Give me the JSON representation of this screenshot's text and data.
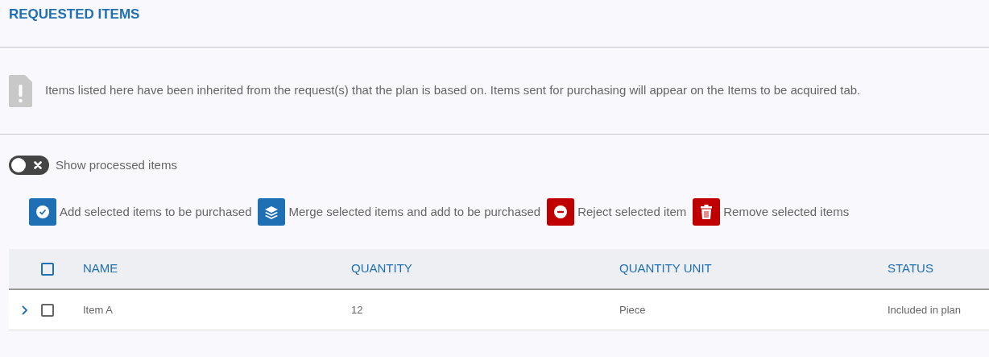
{
  "title": "REQUESTED ITEMS",
  "info": {
    "text": "Items listed here have been inherited from the request(s) that the plan is based on. Items sent for purchasing will appear on the Items to be acquired tab."
  },
  "toggle": {
    "label": "Show processed items",
    "on": false
  },
  "actions": [
    {
      "kind": "add",
      "label": "Add selected items to be purchased"
    },
    {
      "kind": "merge",
      "label": "Merge selected items and add to be purchased"
    },
    {
      "kind": "reject",
      "label": "Reject selected item"
    },
    {
      "kind": "remove",
      "label": "Remove selected items"
    }
  ],
  "table": {
    "select_all": {
      "checked": false
    },
    "columns": [
      "NAME",
      "QUANTITY",
      "QUANTITY UNIT",
      "STATUS"
    ],
    "rows": [
      {
        "expanded": false,
        "checked": false,
        "cells": [
          "Item A",
          "12",
          "Piece",
          "Included in plan"
        ]
      }
    ]
  }
}
